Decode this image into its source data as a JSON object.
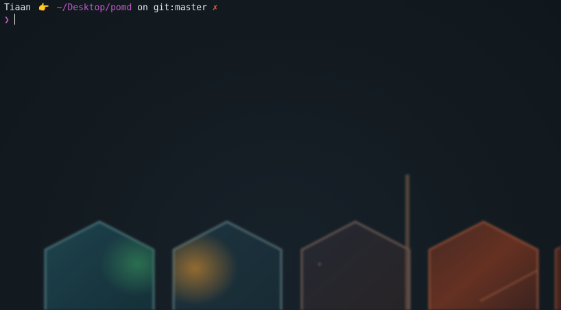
{
  "terminal": {
    "prompt": {
      "user": "Tiaan",
      "pointer_icon": "pointing-hand-icon",
      "pointer_glyph": "👉",
      "path": "~/Desktop/pomd",
      "on_text": "on",
      "git_label": "git:",
      "branch": "master",
      "dirty_mark": "✗"
    },
    "input": {
      "chevron": "❯",
      "value": ""
    }
  },
  "colors": {
    "background": "#121a20",
    "path": "#c25acb",
    "text": "#e8e8e8",
    "dirty": "#e0604a",
    "chevron": "#c25acb"
  }
}
